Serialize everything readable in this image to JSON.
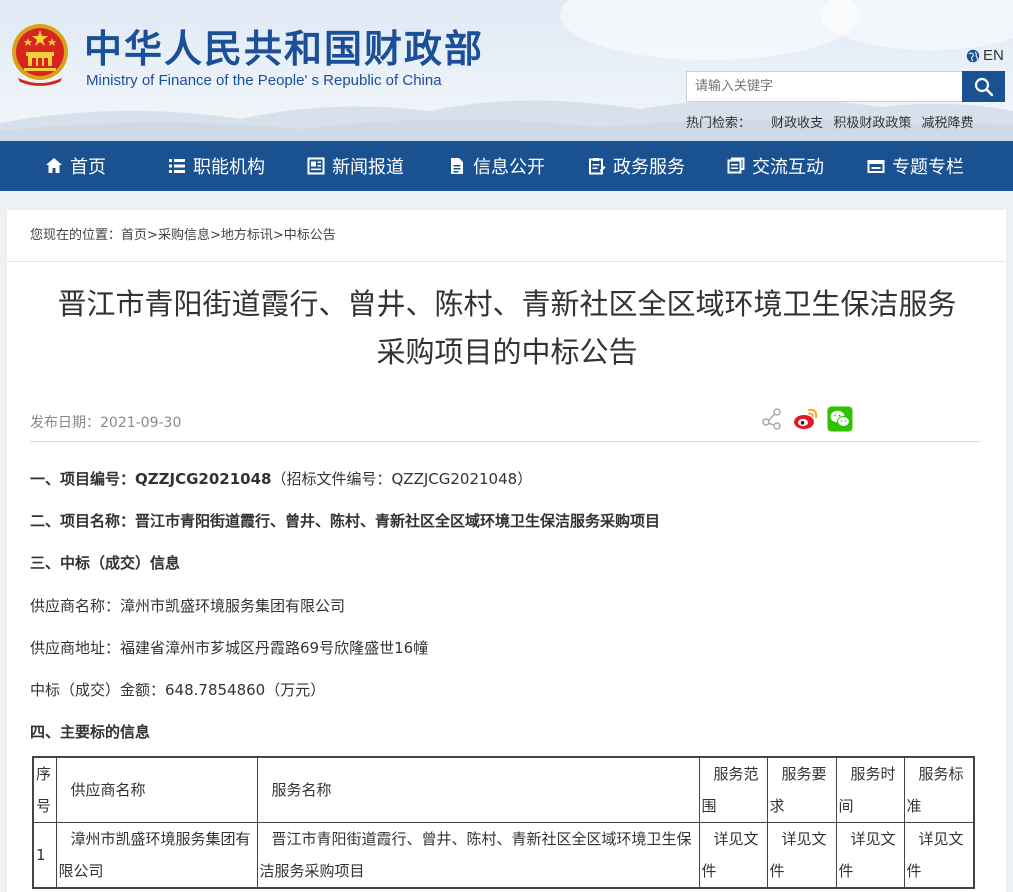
{
  "header": {
    "logo_cn": "中华人民共和国财政部",
    "logo_en": "Ministry of Finance of the People' s Republic of China",
    "lang": "EN",
    "search_placeholder": "请输入关键字",
    "hot_label": "热门检索：",
    "hot_items": [
      "财政收支",
      "积极财政政策",
      "减税降费"
    ]
  },
  "nav": {
    "items": [
      {
        "label": "首页",
        "icon": "home-icon"
      },
      {
        "label": "职能机构",
        "icon": "list-icon"
      },
      {
        "label": "新闻报道",
        "icon": "newspaper-icon"
      },
      {
        "label": "信息公开",
        "icon": "document-icon"
      },
      {
        "label": "政务服务",
        "icon": "clipboard-icon"
      },
      {
        "label": "交流互动",
        "icon": "chat-icon"
      },
      {
        "label": "专题专栏",
        "icon": "window-icon"
      }
    ]
  },
  "breadcrumb": {
    "prefix": "您现在的位置：",
    "items": [
      "首页",
      "采购信息",
      "地方标讯",
      "中标公告"
    ],
    "sep": ">"
  },
  "article": {
    "title_line1": "晋江市青阳街道霞行、曾井、陈村、青新社区全区域环境卫生保洁服务",
    "title_line2": "采购项目的中标公告",
    "pubdate_label": "发布日期：",
    "pubdate": "2021-09-30",
    "s1_label": "一、项目编号：",
    "s1_value": "QZZJCG2021048",
    "s1_note": "（招标文件编号：QZZJCG2021048）",
    "s2_label": "二、项目名称：",
    "s2_value": "晋江市青阳街道霞行、曾井、陈村、青新社区全区域环境卫生保洁服务采购项目",
    "s3": "三、中标（成交）信息",
    "supplier_name": "供应商名称：漳州市凯盛环境服务集团有限公司",
    "supplier_addr": "供应商地址：福建省漳州市芗城区丹霞路69号欣隆盛世16幢",
    "amount": "中标（成交）金额：648.7854860（万元）",
    "s4": "四、主要标的信息"
  },
  "table": {
    "headers": [
      "序号",
      "供应商名称",
      "服务名称",
      "服务范围",
      "服务要求",
      "服务时间",
      "服务标准"
    ],
    "rows": [
      [
        "1",
        "漳州市凯盛环境服务集团有限公司",
        "晋江市青阳街道霞行、曾井、陈村、青新社区全区域环境卫生保洁服务采购项目",
        "详见文件",
        "详见文件",
        "详见文件",
        "详见文件"
      ]
    ]
  }
}
